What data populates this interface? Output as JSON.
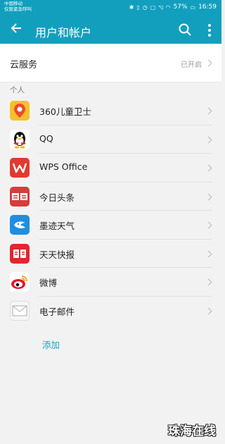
{
  "status_bar": {
    "carrier_line1": "中国移动",
    "carrier_line2": "仅限紧急呼叫",
    "battery": "57%",
    "time": "16:59"
  },
  "app_bar": {
    "title": "用户和帐户"
  },
  "cloud": {
    "label": "云服务",
    "state": "已开启"
  },
  "section_personal": "个人",
  "accounts": [
    {
      "name": "360儿童卫士",
      "icon": "child-guard-icon"
    },
    {
      "name": "QQ",
      "icon": "qq-penguin-icon"
    },
    {
      "name": "WPS Office",
      "icon": "wps-icon"
    },
    {
      "name": "今日头条",
      "icon": "toutiao-icon"
    },
    {
      "name": "墨迹天气",
      "icon": "weather-icon"
    },
    {
      "name": "天天快报",
      "icon": "kuaibao-icon"
    },
    {
      "name": "微博",
      "icon": "weibo-icon"
    },
    {
      "name": "电子邮件",
      "icon": "email-icon"
    }
  ],
  "add_label": "添加",
  "watermark": "珠海在线",
  "colors": {
    "accent": "#129fbd"
  }
}
